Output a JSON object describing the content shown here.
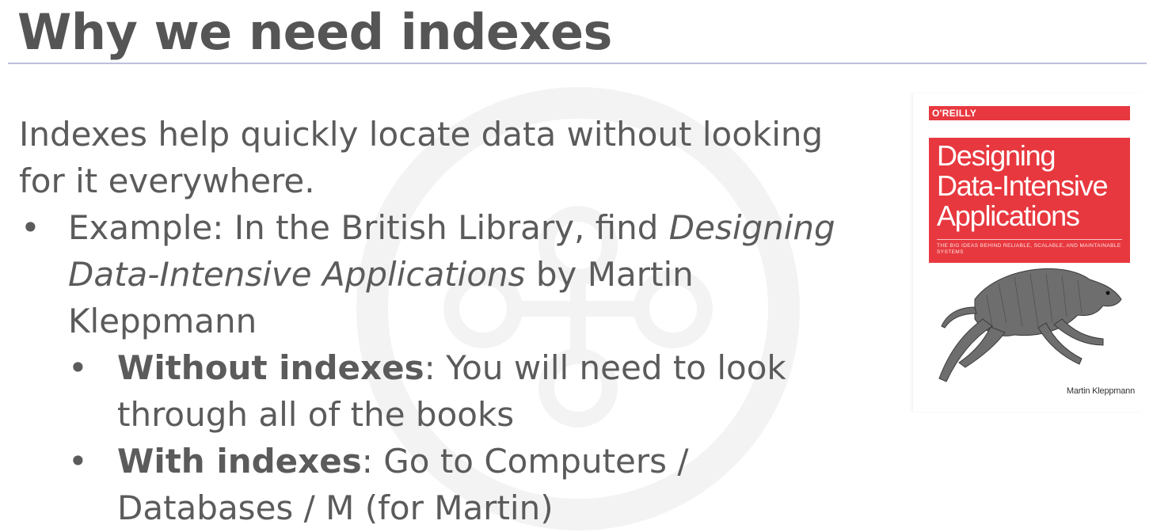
{
  "slide": {
    "title": "Why we need indexes",
    "lead": "Indexes help quickly locate data without looking for it everywhere.",
    "bullet": {
      "prefix": "Example: In the British Library, find",
      "italic": "Designing Data-Intensive Applications",
      "suffix": "by Martin Kleppmann"
    },
    "sub_bullets": [
      {
        "bold": "Without indexes",
        "text": ": You will need to look through all of the books"
      },
      {
        "bold": "With indexes",
        "text": ": Go to Computers / Databases / M (for Martin)"
      }
    ]
  },
  "book": {
    "publisher": "O'REILLY",
    "title": "Designing\nData-Intensive\nApplications",
    "subtitle": "THE BIG IDEAS BEHIND RELIABLE, SCALABLE, AND MAINTAINABLE SYSTEMS",
    "author": "Martin Kleppmann",
    "cover_color": "#e8383f"
  },
  "colors": {
    "text": "#5b5b5b",
    "title": "#555555",
    "rule": "#bfbfe0"
  }
}
